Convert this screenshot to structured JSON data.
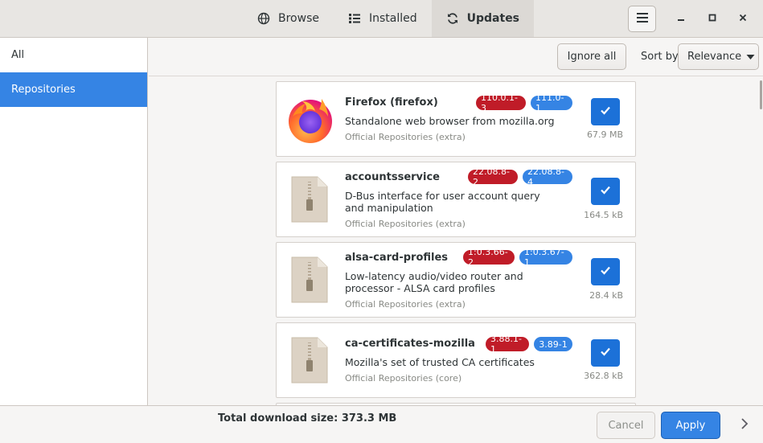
{
  "header": {
    "tabs": [
      {
        "label": "Browse",
        "icon": "globe-icon"
      },
      {
        "label": "Installed",
        "icon": "list-icon"
      },
      {
        "label": "Updates",
        "icon": "refresh-icon",
        "active": true
      }
    ]
  },
  "sidebar": {
    "items": [
      {
        "label": "All"
      },
      {
        "label": "Repositories",
        "selected": true
      }
    ]
  },
  "toolbar": {
    "ignore_label": "Ignore all",
    "sort_label": "Sort by",
    "sort_value": "Relevance"
  },
  "packages": [
    {
      "name": "Firefox (firefox)",
      "old_version": "110.0.1-3",
      "new_version": "111.0-1",
      "description": "Standalone web browser from mozilla.org",
      "repo": "Official Repositories (extra)",
      "size": "67.9 MB",
      "checked": true,
      "icon": "firefox-icon"
    },
    {
      "name": "accountsservice",
      "old_version": "22.08.8-2",
      "new_version": "22.08.8-4",
      "description": "D-Bus interface for user account query and manipulation",
      "repo": "Official Repositories (extra)",
      "size": "164.5 kB",
      "checked": true,
      "icon": "package-archive-icon"
    },
    {
      "name": "alsa-card-profiles",
      "old_version": "1:0.3.66-2",
      "new_version": "1:0.3.67-1",
      "description": "Low-latency audio/video router and processor - ALSA card profiles",
      "repo": "Official Repositories (extra)",
      "size": "28.4 kB",
      "checked": true,
      "icon": "package-archive-icon"
    },
    {
      "name": "ca-certificates-mozilla",
      "old_version": "3.88.1-1",
      "new_version": "3.89-1",
      "description": "Mozilla's set of trusted CA certificates",
      "repo": "Official Repositories (core)",
      "size": "362.8 kB",
      "checked": true,
      "icon": "package-archive-icon"
    }
  ],
  "footer": {
    "total": "Total download size: 373.3 MB",
    "cancel_label": "Cancel",
    "apply_label": "Apply"
  },
  "colors": {
    "accent": "#3584e4",
    "old_badge": "#c01c28",
    "new_badge": "#3584e4"
  }
}
